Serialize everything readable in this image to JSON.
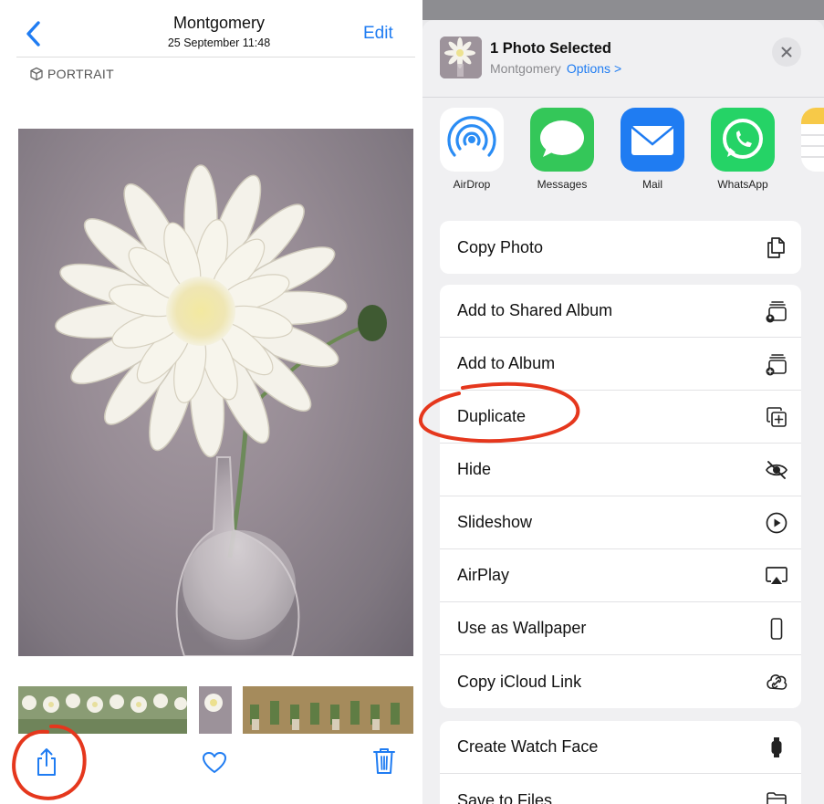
{
  "viewer": {
    "title": "Montgomery",
    "subtitle": "25 September  11:48",
    "edit_label": "Edit",
    "badge_label": "PORTRAIT",
    "icons": [
      "chevron-left-icon",
      "cube-icon",
      "share-icon",
      "heart-icon",
      "trash-icon"
    ]
  },
  "share_sheet": {
    "header_title": "1 Photo Selected",
    "header_subtitle": "Montgomery",
    "options_label": "Options >",
    "apps": [
      {
        "label": "AirDrop",
        "icon": "airdrop-icon",
        "color": "#2a8cf4"
      },
      {
        "label": "Messages",
        "icon": "messages-icon",
        "color": "#34c759"
      },
      {
        "label": "Mail",
        "icon": "mail-icon",
        "color": "#1f7cf2"
      },
      {
        "label": "WhatsApp",
        "icon": "whatsapp-icon",
        "color": "#25d366"
      }
    ],
    "group1": [
      {
        "label": "Copy Photo",
        "icon": "copy-photo-icon"
      }
    ],
    "group2": [
      {
        "label": "Add to Shared Album",
        "icon": "shared-album-icon"
      },
      {
        "label": "Add to Album",
        "icon": "add-album-icon"
      },
      {
        "label": "Duplicate",
        "icon": "duplicate-icon"
      },
      {
        "label": "Hide",
        "icon": "eye-slash-icon"
      },
      {
        "label": "Slideshow",
        "icon": "play-circle-icon"
      },
      {
        "label": "AirPlay",
        "icon": "airplay-icon"
      },
      {
        "label": "Use as Wallpaper",
        "icon": "phone-icon"
      },
      {
        "label": "Copy iCloud Link",
        "icon": "link-icon"
      }
    ],
    "group3": [
      {
        "label": "Create Watch Face",
        "icon": "watch-icon"
      },
      {
        "label": "Save to Files",
        "icon": "folder-icon"
      }
    ]
  },
  "colors": {
    "accent": "#1f7cf2",
    "annotation": "#e5371d"
  }
}
